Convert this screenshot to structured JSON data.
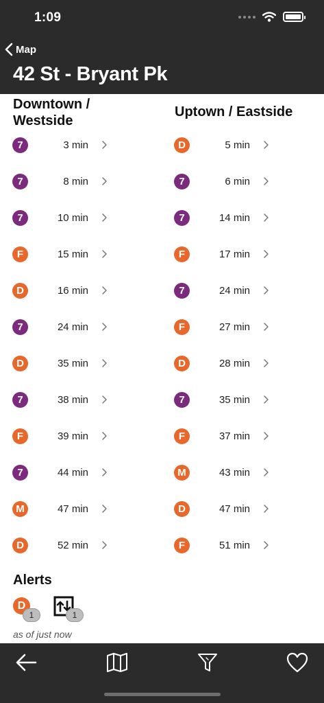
{
  "status": {
    "time": "1:09"
  },
  "nav": {
    "back_label": "Map",
    "title": "42 St - Bryant Pk"
  },
  "colors": {
    "line7": "#7b2a7d",
    "lineOrange": "#e8672a",
    "header": "#2b2b2b"
  },
  "downtown": {
    "title": "Downtown / Westside",
    "rows": [
      {
        "line": "7",
        "eta": "3 min"
      },
      {
        "line": "7",
        "eta": "8 min"
      },
      {
        "line": "7",
        "eta": "10 min"
      },
      {
        "line": "F",
        "eta": "15 min"
      },
      {
        "line": "D",
        "eta": "16 min"
      },
      {
        "line": "7",
        "eta": "24 min"
      },
      {
        "line": "D",
        "eta": "35 min"
      },
      {
        "line": "7",
        "eta": "38 min"
      },
      {
        "line": "F",
        "eta": "39 min"
      },
      {
        "line": "7",
        "eta": "44 min"
      },
      {
        "line": "M",
        "eta": "47 min"
      },
      {
        "line": "D",
        "eta": "52 min"
      }
    ]
  },
  "uptown": {
    "title": "Uptown / Eastside",
    "rows": [
      {
        "line": "D",
        "eta": "5 min"
      },
      {
        "line": "7",
        "eta": "6 min"
      },
      {
        "line": "7",
        "eta": "14 min"
      },
      {
        "line": "F",
        "eta": "17 min"
      },
      {
        "line": "7",
        "eta": "24 min"
      },
      {
        "line": "F",
        "eta": "27 min"
      },
      {
        "line": "D",
        "eta": "28 min"
      },
      {
        "line": "7",
        "eta": "35 min"
      },
      {
        "line": "F",
        "eta": "37 min"
      },
      {
        "line": "M",
        "eta": "43 min"
      },
      {
        "line": "D",
        "eta": "47 min"
      },
      {
        "line": "F",
        "eta": "51 min"
      }
    ]
  },
  "alerts": {
    "title": "Alerts",
    "items": [
      {
        "icon": "line-D-badge",
        "line": "D",
        "count": "1"
      },
      {
        "icon": "elevator-icon",
        "count": "1"
      }
    ],
    "as_of": "as of just now"
  },
  "tabbar": {
    "items": [
      {
        "icon": "back-arrow-icon"
      },
      {
        "icon": "map-icon"
      },
      {
        "icon": "filter-icon"
      },
      {
        "icon": "heart-icon"
      }
    ]
  }
}
